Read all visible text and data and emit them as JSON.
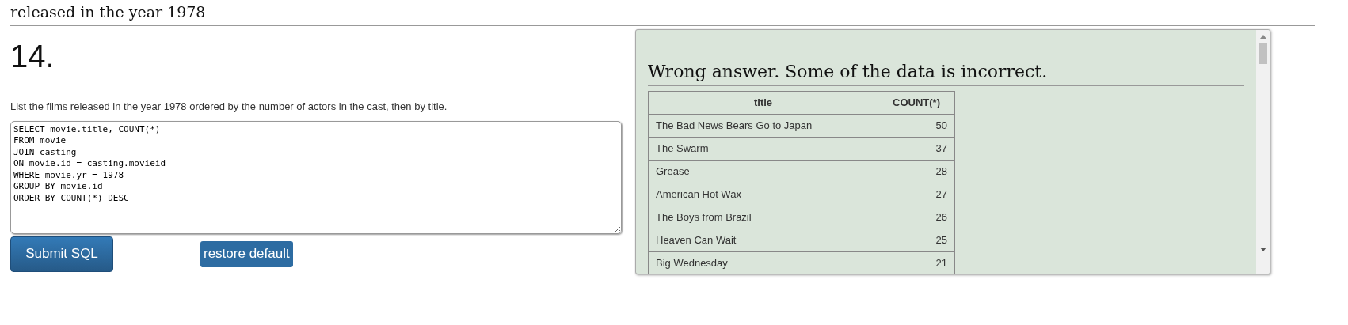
{
  "section_heading": "released in the year 1978",
  "question": {
    "number": "14.",
    "prompt": "List the films released in the year 1978 ordered by the number of actors in the cast, then by title.",
    "sql": "SELECT movie.title, COUNT(*)\nFROM movie\nJOIN casting\nON movie.id = casting.movieid\nWHERE movie.yr = 1978\nGROUP BY movie.id\nORDER BY COUNT(*) DESC",
    "buttons": [
      "Submit SQL",
      "restore default"
    ]
  },
  "result": {
    "message": "Wrong answer. Some of the data is incorrect.",
    "table": {
      "columns": [
        "title",
        "COUNT(*)"
      ],
      "rows": [
        [
          "The Bad News Bears Go to Japan",
          "50"
        ],
        [
          "The Swarm",
          "37"
        ],
        [
          "Grease",
          "28"
        ],
        [
          "American Hot Wax",
          "27"
        ],
        [
          "The Boys from Brazil",
          "26"
        ],
        [
          "Heaven Can Wait",
          "25"
        ],
        [
          "Big Wednesday",
          "21"
        ]
      ]
    }
  }
}
